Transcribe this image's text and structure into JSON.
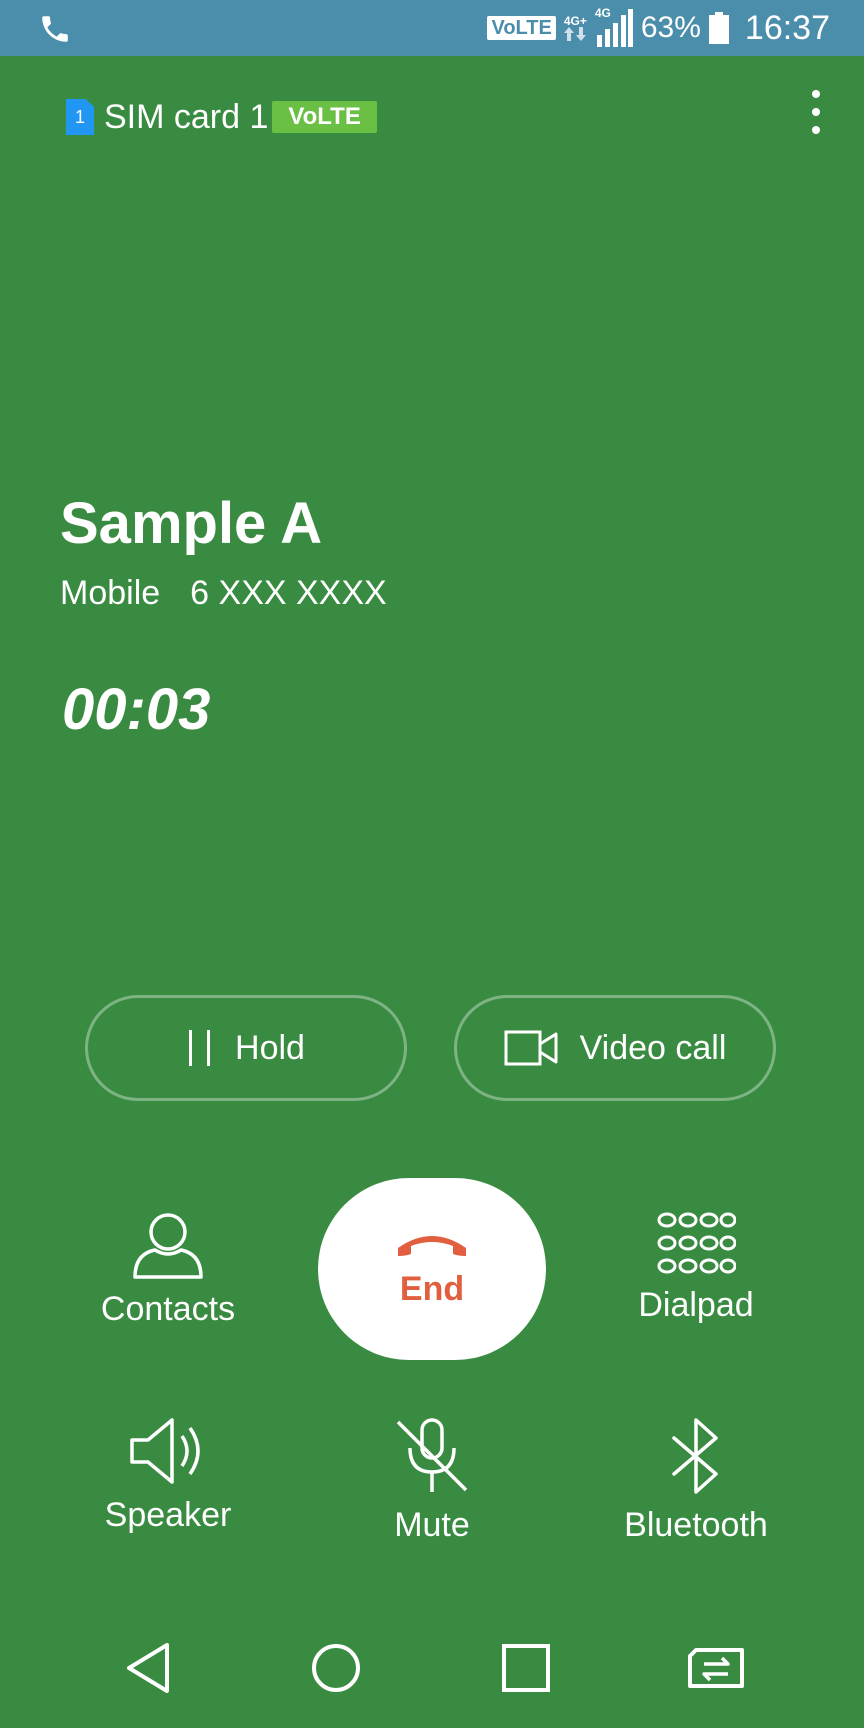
{
  "status_bar": {
    "volte": "VoLTE",
    "net_top": "4G+",
    "net_small": "4G",
    "battery": "63%",
    "time": "16:37"
  },
  "sim": {
    "number": "1",
    "label": "SIM card 1",
    "badge": "VoLTE"
  },
  "caller": {
    "name": "Sample A",
    "type": "Mobile",
    "number": "6 XXX XXXX"
  },
  "call": {
    "timer": "00:03"
  },
  "pills": {
    "hold": "Hold",
    "video": "Video call"
  },
  "actions": {
    "contacts": "Contacts",
    "end": "End",
    "dialpad": "Dialpad",
    "speaker": "Speaker",
    "mute": "Mute",
    "bluetooth": "Bluetooth"
  },
  "colors": {
    "background": "#3a8b42",
    "status_bar": "#4b8eac",
    "end_accent": "#e15e3f",
    "volte_chip": "#6abf45",
    "sim_icon": "#2196f3"
  },
  "icons": {
    "status_left": "phone-icon",
    "hold": "pause-icon",
    "video": "video-camera-icon",
    "contacts": "person-icon",
    "end": "phone-hangup-icon",
    "dialpad": "dialpad-icon",
    "speaker": "speaker-icon",
    "mute": "mic-off-icon",
    "bluetooth": "bluetooth-icon",
    "nav": [
      "back-icon",
      "home-icon",
      "recents-icon",
      "switch-sim-icon"
    ]
  }
}
